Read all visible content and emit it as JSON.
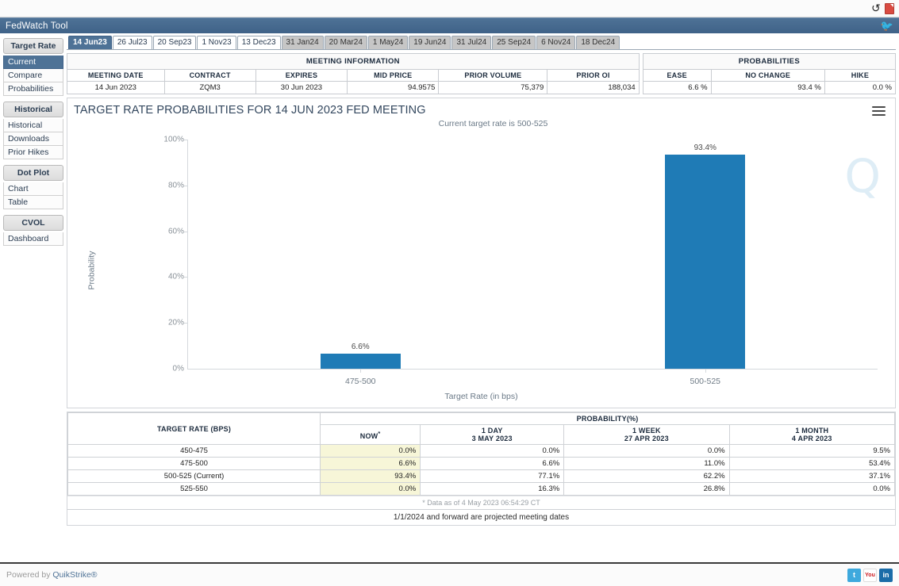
{
  "window": {
    "title": "FedWatch Tool",
    "refresh_icon": "refresh-icon",
    "pdf_icon": "pdf-icon",
    "twitter_icon": "twitter-icon"
  },
  "sidebar": {
    "groups": [
      {
        "title": "Target Rate",
        "items": [
          {
            "label": "Current",
            "active": true
          },
          {
            "label": "Compare",
            "active": false
          },
          {
            "label": "Probabilities",
            "active": false
          }
        ]
      },
      {
        "title": "Historical",
        "items": [
          {
            "label": "Historical",
            "active": false
          },
          {
            "label": "Downloads",
            "active": false
          },
          {
            "label": "Prior Hikes",
            "active": false
          }
        ]
      },
      {
        "title": "Dot Plot",
        "items": [
          {
            "label": "Chart",
            "active": false
          },
          {
            "label": "Table",
            "active": false
          }
        ]
      },
      {
        "title": "CVOL",
        "items": [
          {
            "label": "Dashboard",
            "active": false
          }
        ]
      }
    ]
  },
  "tabs": [
    {
      "label": "14 Jun23",
      "state": "active"
    },
    {
      "label": "26 Jul23",
      "state": "white"
    },
    {
      "label": "20 Sep23",
      "state": "white"
    },
    {
      "label": "1 Nov23",
      "state": "white"
    },
    {
      "label": "13 Dec23",
      "state": "white"
    },
    {
      "label": "31 Jan24",
      "state": "gray"
    },
    {
      "label": "20 Mar24",
      "state": "gray"
    },
    {
      "label": "1 May24",
      "state": "gray"
    },
    {
      "label": "19 Jun24",
      "state": "gray"
    },
    {
      "label": "31 Jul24",
      "state": "gray"
    },
    {
      "label": "25 Sep24",
      "state": "gray"
    },
    {
      "label": "6 Nov24",
      "state": "gray"
    },
    {
      "label": "18 Dec24",
      "state": "gray"
    }
  ],
  "meeting_information": {
    "group_header": "MEETING INFORMATION",
    "columns": [
      "MEETING DATE",
      "CONTRACT",
      "EXPIRES",
      "MID PRICE",
      "PRIOR VOLUME",
      "PRIOR OI"
    ],
    "row": {
      "meeting_date": "14 Jun 2023",
      "contract": "ZQM3",
      "expires": "30 Jun 2023",
      "mid_price": "94.9575",
      "prior_volume": "75,379",
      "prior_oi": "188,034"
    }
  },
  "probabilities_summary": {
    "group_header": "PROBABILITIES",
    "columns": [
      "EASE",
      "NO CHANGE",
      "HIKE"
    ],
    "row": {
      "ease": "6.6 %",
      "no_change": "93.4 %",
      "hike": "0.0 %"
    }
  },
  "chart_data": {
    "type": "bar",
    "title": "TARGET RATE PROBABILITIES FOR 14 JUN 2023 FED MEETING",
    "subtitle": "Current target rate is 500-525",
    "xlabel": "Target Rate (in bps)",
    "ylabel": "Probability",
    "categories": [
      "475-500",
      "500-525"
    ],
    "values": [
      6.6,
      93.4
    ],
    "value_labels": [
      "6.6%",
      "93.4%"
    ],
    "ylim": [
      0,
      100
    ],
    "yticks": [
      "0%",
      "20%",
      "40%",
      "60%",
      "80%",
      "100%"
    ],
    "ytick_values": [
      0,
      20,
      40,
      60,
      80,
      100
    ],
    "grid": false,
    "legend": "none",
    "bar_color": "#1f7bb6",
    "watermark": "Q",
    "menu_icon": "hamburger-menu-icon"
  },
  "probability_table": {
    "headers": {
      "target_rate": "TARGET RATE (BPS)",
      "probability_group": "PROBABILITY(%)",
      "cols": [
        {
          "line1": "NOW",
          "line2": "",
          "star": "*"
        },
        {
          "line1": "1 DAY",
          "line2": "3 MAY 2023",
          "star": ""
        },
        {
          "line1": "1 WEEK",
          "line2": "27 APR 2023",
          "star": ""
        },
        {
          "line1": "1 MONTH",
          "line2": "4 APR 2023",
          "star": ""
        }
      ]
    },
    "rows": [
      {
        "rate": "450-475",
        "now": "0.0%",
        "day": "0.0%",
        "week": "0.0%",
        "month": "9.5%"
      },
      {
        "rate": "475-500",
        "now": "6.6%",
        "day": "6.6%",
        "week": "11.0%",
        "month": "53.4%"
      },
      {
        "rate": "500-525 (Current)",
        "now": "93.4%",
        "day": "77.1%",
        "week": "62.2%",
        "month": "37.1%"
      },
      {
        "rate": "525-550",
        "now": "0.0%",
        "day": "16.3%",
        "week": "26.8%",
        "month": "0.0%"
      }
    ],
    "note": "* Data as of 4 May 2023 06:54:29 CT",
    "note2": "1/1/2024 and forward are projected meeting dates"
  },
  "footer": {
    "powered_prefix": "Powered by ",
    "powered_brand": "QuikStrike®",
    "social": [
      {
        "name": "twitter",
        "glyph": "t"
      },
      {
        "name": "youtube",
        "glyph": "You"
      },
      {
        "name": "linkedin",
        "glyph": "in"
      }
    ]
  }
}
